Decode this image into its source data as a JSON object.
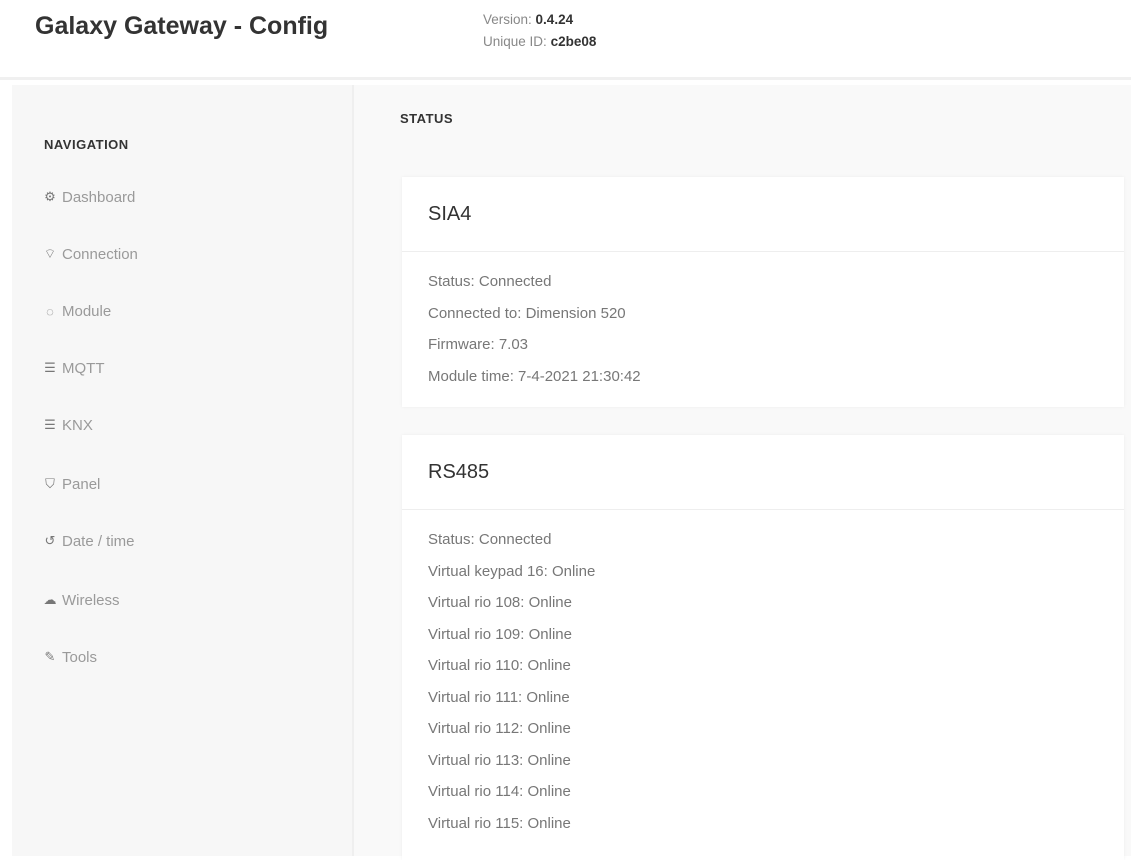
{
  "header": {
    "title": "Galaxy Gateway - Config",
    "version_label": "Version:",
    "version_value": "0.4.24",
    "uid_label": "Unique ID:",
    "uid_value": "c2be08"
  },
  "sidebar": {
    "heading": "NAVIGATION",
    "items": [
      {
        "label": "Dashboard",
        "icon": "dashboard-icon",
        "glyph": "⚙"
      },
      {
        "label": "Connection",
        "icon": "wifi-icon",
        "glyph": "⌔"
      },
      {
        "label": "Module",
        "icon": "circle-icon",
        "glyph": "◌"
      },
      {
        "label": "MQTT",
        "icon": "list-icon",
        "glyph": "☰"
      },
      {
        "label": "KNX",
        "icon": "list-icon",
        "glyph": "☰"
      },
      {
        "label": "Panel",
        "icon": "shield-icon",
        "glyph": "⛉"
      },
      {
        "label": "Date / time",
        "icon": "history-icon",
        "glyph": "↺"
      },
      {
        "label": "Wireless",
        "icon": "cloud-icon",
        "glyph": "☁"
      },
      {
        "label": "Tools",
        "icon": "wrench-icon",
        "glyph": "✎"
      }
    ]
  },
  "main": {
    "section_title": "STATUS",
    "cards": [
      {
        "title": "SIA4",
        "lines": [
          "Status: Connected",
          "Connected to: Dimension 520",
          "Firmware: 7.03",
          "Module time: 7-4-2021 21:30:42"
        ]
      },
      {
        "title": "RS485",
        "lines": [
          "Status: Connected",
          "Virtual keypad 16: Online",
          "Virtual rio 108: Online",
          "Virtual rio 109: Online",
          "Virtual rio 110: Online",
          "Virtual rio 111: Online",
          "Virtual rio 112: Online",
          "Virtual rio 113: Online",
          "Virtual rio 114: Online",
          "Virtual rio 115: Online"
        ]
      }
    ]
  },
  "colors": {
    "sidebar_bg": "#f7f7f7",
    "main_bg": "#f9f9f9",
    "card_bg": "#ffffff",
    "text_dark": "#333333",
    "text_muted": "#9a9a9a"
  }
}
